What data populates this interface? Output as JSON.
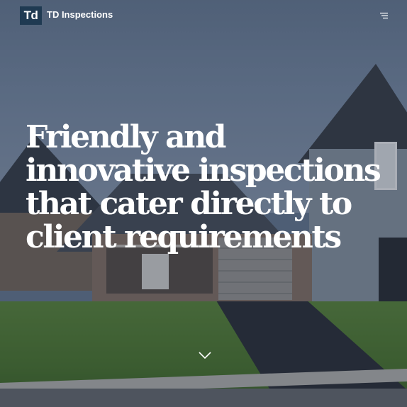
{
  "header": {
    "logo_text": "Td",
    "brand_name": "TD Inspections",
    "logo_color": "#1f3a52",
    "menu_icon": "menu-icon"
  },
  "hero": {
    "headline": "Friendly and innovative inspections that cater directly to client requirements",
    "background_image": "suburban-house-photo",
    "scroll_icon": "chevron-down-icon"
  }
}
